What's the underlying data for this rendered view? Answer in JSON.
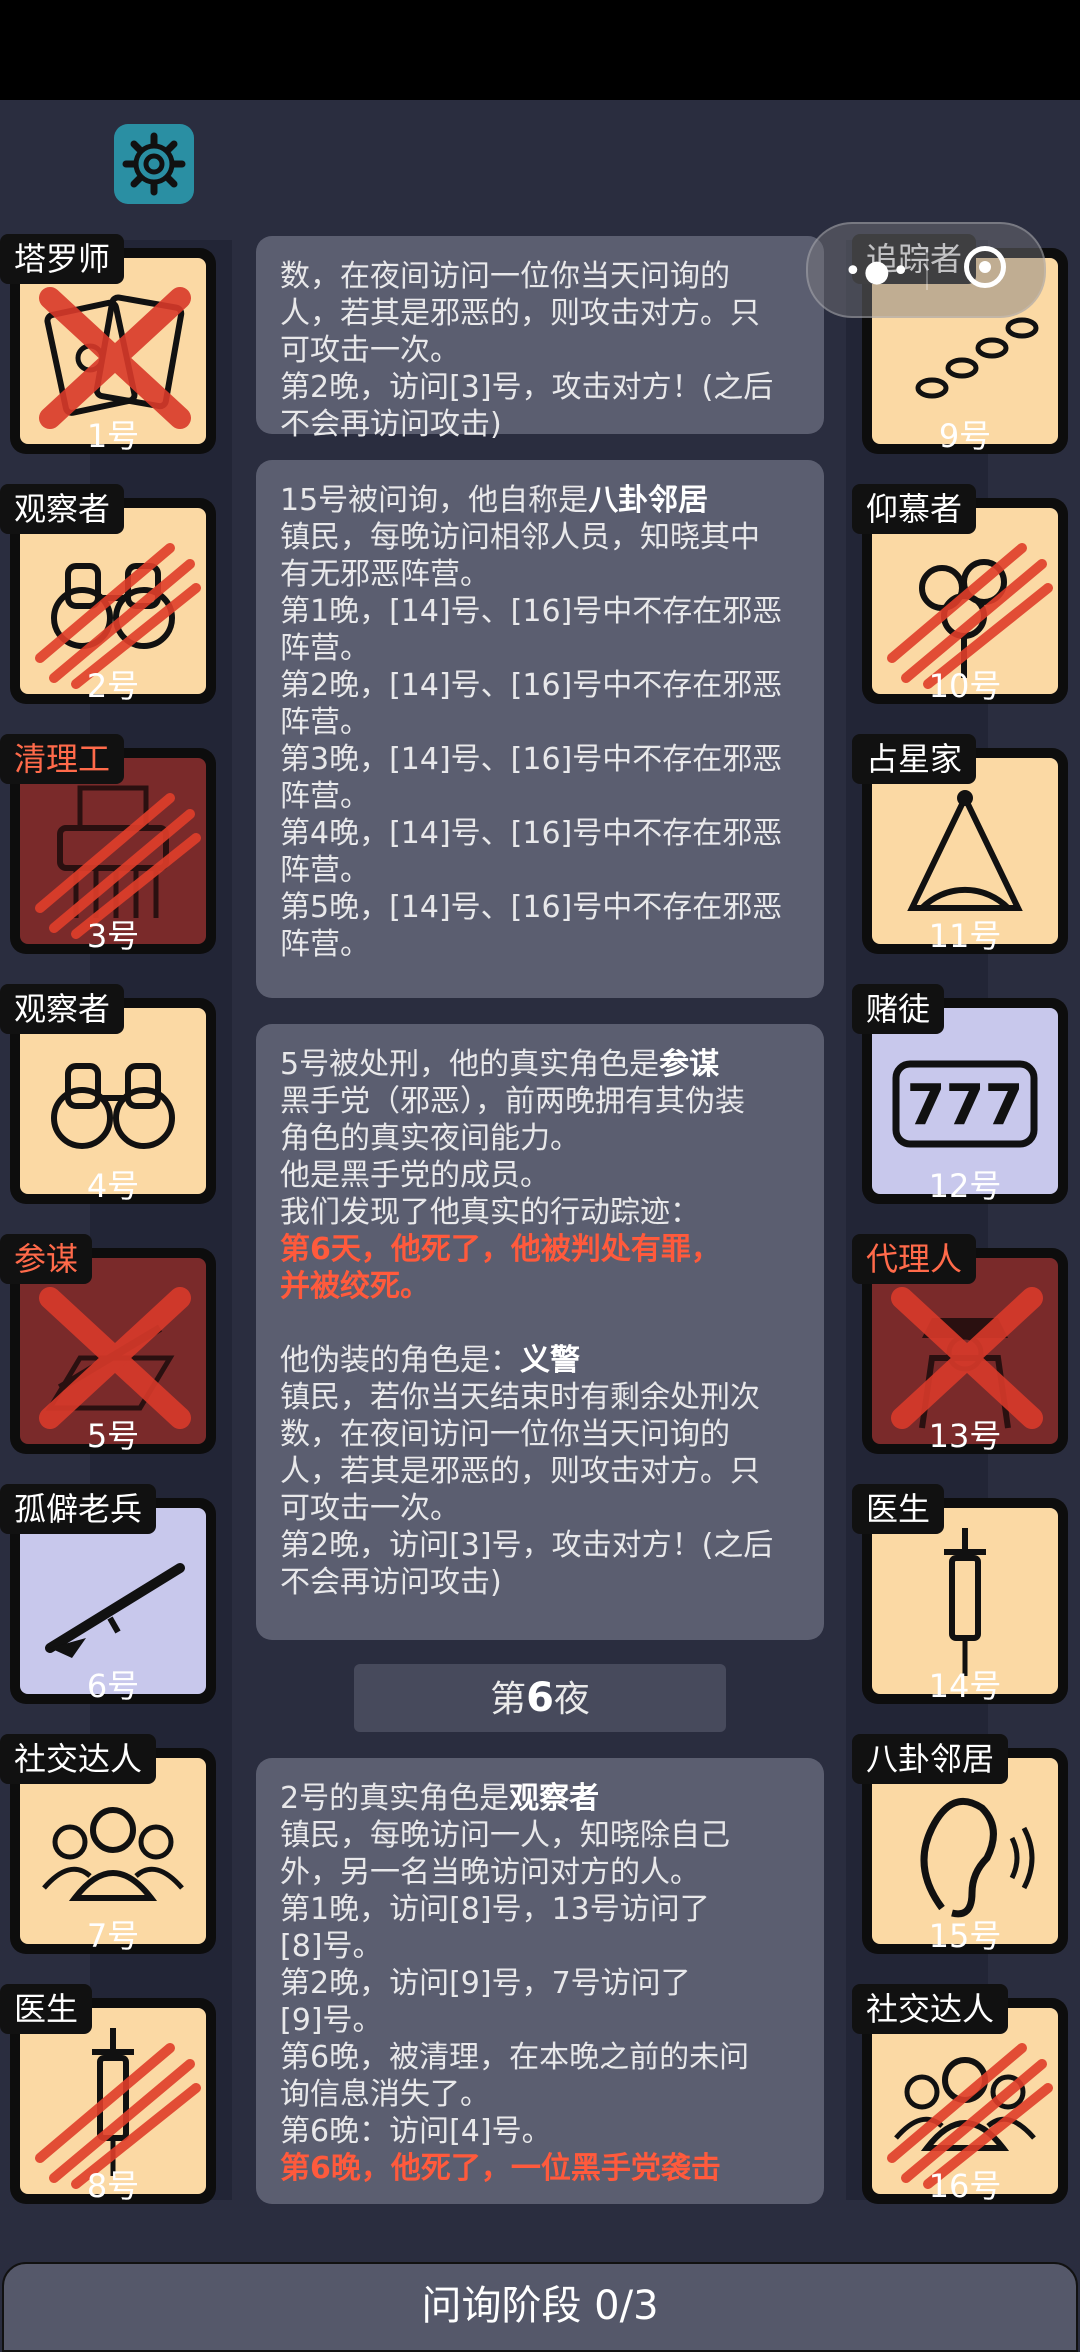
{
  "players_left": [
    {
      "label": "塔罗师",
      "num": "1号",
      "bg": "#fbd9a4",
      "dead": "cross",
      "icon": "tarot-icon"
    },
    {
      "label": "观察者",
      "num": "2号",
      "bg": "#fbd9a4",
      "dead": "claw",
      "icon": "binoculars-icon"
    },
    {
      "label": "清理工",
      "num": "3号",
      "bg": "#7a2a2a",
      "dead": "claw",
      "icon": "shredder-icon",
      "label_color": "#ff6a4a"
    },
    {
      "label": "观察者",
      "num": "4号",
      "bg": "#fbd9a4",
      "dead": "",
      "icon": "binoculars-icon"
    },
    {
      "label": "参谋",
      "num": "5号",
      "bg": "#7a2a2a",
      "dead": "cross",
      "icon": "scroll-icon",
      "label_color": "#ff6a4a"
    },
    {
      "label": "孤僻老兵",
      "num": "6号",
      "bg": "#c8c8ec",
      "dead": "",
      "icon": "rifle-icon"
    },
    {
      "label": "社交达人",
      "num": "7号",
      "bg": "#fbd9a4",
      "dead": "",
      "icon": "people-icon"
    },
    {
      "label": "医生",
      "num": "8号",
      "bg": "#fbd9a4",
      "dead": "claw",
      "icon": "syringe-icon"
    }
  ],
  "players_right": [
    {
      "label": "追踪者",
      "num": "9号",
      "bg": "#fbd9a4",
      "dead": "",
      "icon": "footprints-icon"
    },
    {
      "label": "仰慕者",
      "num": "10号",
      "bg": "#fbd9a4",
      "dead": "claw",
      "icon": "bouquet-icon"
    },
    {
      "label": "占星家",
      "num": "11号",
      "bg": "#fbd9a4",
      "dead": "",
      "icon": "sextant-icon"
    },
    {
      "label": "赌徒",
      "num": "12号",
      "bg": "#c8c8ec",
      "dead": "",
      "icon": "slot-777-icon"
    },
    {
      "label": "代理人",
      "num": "13号",
      "bg": "#7a2a2a",
      "dead": "cross",
      "icon": "agent-icon",
      "label_color": "#ff6a4a"
    },
    {
      "label": "医生",
      "num": "14号",
      "bg": "#fbd9a4",
      "dead": "",
      "icon": "syringe-icon"
    },
    {
      "label": "八卦邻居",
      "num": "15号",
      "bg": "#fbd9a4",
      "dead": "",
      "icon": "ear-icon"
    },
    {
      "label": "社交达人",
      "num": "16号",
      "bg": "#fbd9a4",
      "dead": "claw",
      "icon": "people-icon"
    }
  ],
  "log": {
    "msg1": [
      "数，在夜间访问一位你当天问询的",
      "人，若其是邪恶的，则攻击对方。只",
      "可攻击一次。",
      "第2晚，访问[3]号，攻击对方！(之后",
      "不会再访问攻击)"
    ],
    "msg2_head": "15号被问询，他自称是",
    "msg2_role": "八卦邻居",
    "msg2_body": [
      "镇民，每晚访问相邻人员，知晓其中",
      "有无邪恶阵营。",
      "第1晚，[14]号、[16]号中不存在邪恶",
      "阵营。",
      "第2晚，[14]号、[16]号中不存在邪恶",
      "阵营。",
      "第3晚，[14]号、[16]号中不存在邪恶",
      "阵营。",
      "第4晚，[14]号、[16]号中不存在邪恶",
      "阵营。",
      "第5晚，[14]号、[16]号中不存在邪恶",
      "阵营。"
    ],
    "msg3_head": "5号被处刑，他的真实角色是",
    "msg3_role": "参谋",
    "msg3_body": [
      "黑手党（邪恶），前两晚拥有其伪装",
      "角色的真实夜间能力。",
      "他是黑手党的成员。",
      "我们发现了他真实的行动踪迹："
    ],
    "msg3_red": [
      "第6天，他死了，他被判处有罪，",
      "并被绞死。"
    ],
    "msg3_fake_head": "他伪装的角色是：",
    "msg3_fake_role": "义警",
    "msg3_fake_body": [
      "镇民，若你当天结束时有剩余处刑次",
      "数，在夜间访问一位你当天问询的",
      "人，若其是邪恶的，则攻击对方。只",
      "可攻击一次。",
      "第2晚，访问[3]号，攻击对方！(之后",
      "不会再访问攻击)"
    ],
    "night_prefix": "第",
    "night_num": "6",
    "night_suffix": "夜",
    "msg4_head": "2号的真实角色是",
    "msg4_role": "观察者",
    "msg4_body": [
      "镇民，每晚访问一人，知晓除自己",
      "外，另一名当晚访问对方的人。",
      "第1晚，访问[8]号，13号访问了",
      "[8]号。",
      "第2晚，访问[9]号，7号访问了",
      "[9]号。",
      "第6晚，被清理，在本晚之前的未问",
      "询信息消失了。",
      "第6晚：访问[4]号。"
    ],
    "msg4_red": "第6晚，他死了，一位黑手党袭击"
  },
  "status": "问询阶段 0/3",
  "colors": {
    "accent_red": "#ff5a3c",
    "gear_bg": "#2a8fa3"
  }
}
